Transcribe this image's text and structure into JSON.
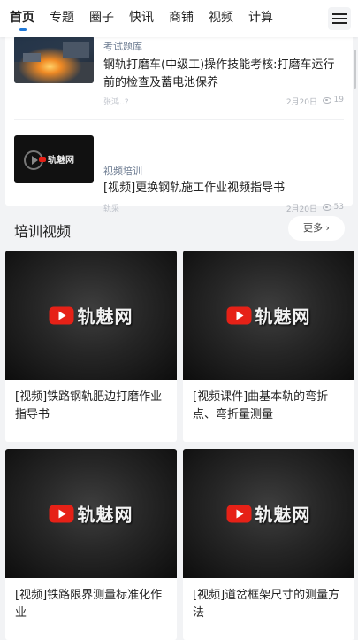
{
  "nav": {
    "tabs": [
      "首页",
      "专题",
      "圈子",
      "快讯",
      "商铺",
      "视频",
      "计算"
    ],
    "active_index": 0,
    "menu_icon": "hamburger-menu-icon"
  },
  "list": [
    {
      "category": "考试题库",
      "title": "钢轨打磨车(中级工)操作技能考核:打磨车运行前的检查及蓄电池保养",
      "author": "张鸿..?",
      "date": "2月20日",
      "views": "19"
    },
    {
      "category": "视频培训",
      "title": "[视频]更换钢轨施工作业视频指导书",
      "author": "轨采",
      "date": "2月20日",
      "views": "53",
      "thumb_logo": "轨魅网"
    }
  ],
  "section": {
    "title": "培训视频",
    "more_label": "更多"
  },
  "videos": [
    {
      "title": "[视频]铁路钢轨肥边打磨作业指导书",
      "logo": "轨魅网"
    },
    {
      "title": "[视频课件]曲基本轨的弯折点、弯折量测量",
      "logo": "轨魅网"
    },
    {
      "title": "[视频]铁路限界测量标准化作业",
      "logo": "轨魅网"
    },
    {
      "title": "[视频]道岔框架尺寸的测量方法",
      "logo": "轨魅网"
    }
  ],
  "colors": {
    "accent": "#1e78d8",
    "page_bg": "#f2f3f5",
    "category_text": "#6b7a90"
  }
}
